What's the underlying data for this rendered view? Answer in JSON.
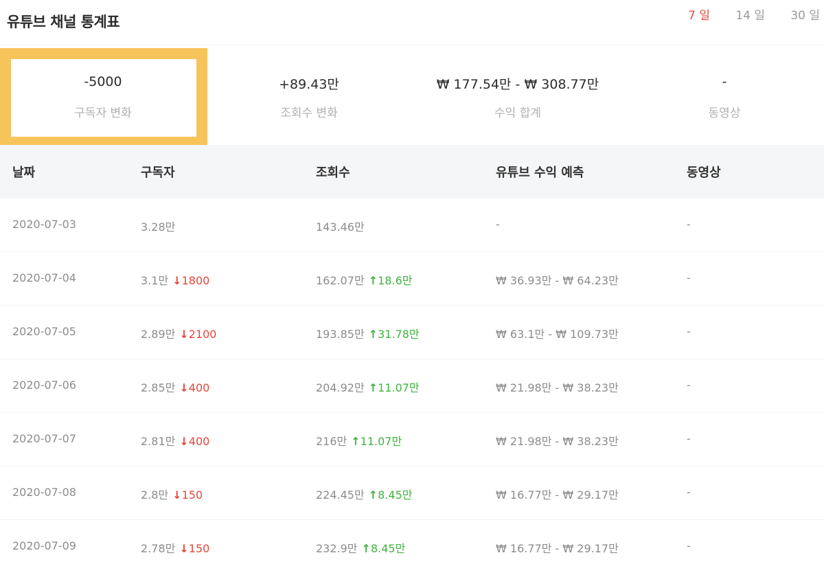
{
  "header": {
    "title": "유튜브 채널 통계표",
    "range_tabs": [
      {
        "label": "7 일",
        "active": true
      },
      {
        "label": "14 일",
        "active": false
      },
      {
        "label": "30 일",
        "active": false
      }
    ]
  },
  "summary": [
    {
      "value": "-5000",
      "label": "구독자 변화"
    },
    {
      "value": "+89.43만",
      "label": "조회수 변화"
    },
    {
      "value": "₩ 177.54만 - ₩ 308.77만",
      "label": "수익 합계"
    },
    {
      "value": "-",
      "label": "동영상"
    }
  ],
  "table": {
    "columns": [
      "날짜",
      "구독자",
      "조회수",
      "유튜브 수익 예측",
      "동영상"
    ],
    "rows": [
      {
        "date": "2020-07-03",
        "subs": "3.28만",
        "subs_delta": "",
        "subs_arrow": "",
        "views": "143.46만",
        "views_delta": "",
        "views_arrow": "",
        "revenue": "-",
        "videos": "-"
      },
      {
        "date": "2020-07-04",
        "subs": "3.1만",
        "subs_delta": "1800",
        "subs_arrow": "↓",
        "views": "162.07만",
        "views_delta": "18.6만",
        "views_arrow": "↑",
        "revenue": "₩ 36.93만 - ₩ 64.23만",
        "videos": "-"
      },
      {
        "date": "2020-07-05",
        "subs": "2.89만",
        "subs_delta": "2100",
        "subs_arrow": "↓",
        "views": "193.85만",
        "views_delta": "31.78만",
        "views_arrow": "↑",
        "revenue": "₩ 63.1만 - ₩ 109.73만",
        "videos": "-"
      },
      {
        "date": "2020-07-06",
        "subs": "2.85만",
        "subs_delta": "400",
        "subs_arrow": "↓",
        "views": "204.92만",
        "views_delta": "11.07만",
        "views_arrow": "↑",
        "revenue": "₩ 21.98만 - ₩ 38.23만",
        "videos": "-"
      },
      {
        "date": "2020-07-07",
        "subs": "2.81만",
        "subs_delta": "400",
        "subs_arrow": "↓",
        "views": "216만",
        "views_delta": "11.07만",
        "views_arrow": "↑",
        "revenue": "₩ 21.98만 - ₩ 38.23만",
        "videos": "-"
      },
      {
        "date": "2020-07-08",
        "subs": "2.8만",
        "subs_delta": "150",
        "subs_arrow": "↓",
        "views": "224.45만",
        "views_delta": "8.45만",
        "views_arrow": "↑",
        "revenue": "₩ 16.77만 - ₩ 29.17만",
        "videos": "-"
      },
      {
        "date": "2020-07-09",
        "subs": "2.78만",
        "subs_delta": "150",
        "subs_arrow": "↓",
        "views": "232.9만",
        "views_delta": "8.45만",
        "views_arrow": "↑",
        "revenue": "₩ 16.77만 - ₩ 29.17만",
        "videos": "-"
      }
    ]
  },
  "colors": {
    "accent_red": "#e4473c",
    "accent_green": "#3fb33f",
    "highlight_yellow": "#f7c45c",
    "header_bg": "#f5f6f8"
  }
}
